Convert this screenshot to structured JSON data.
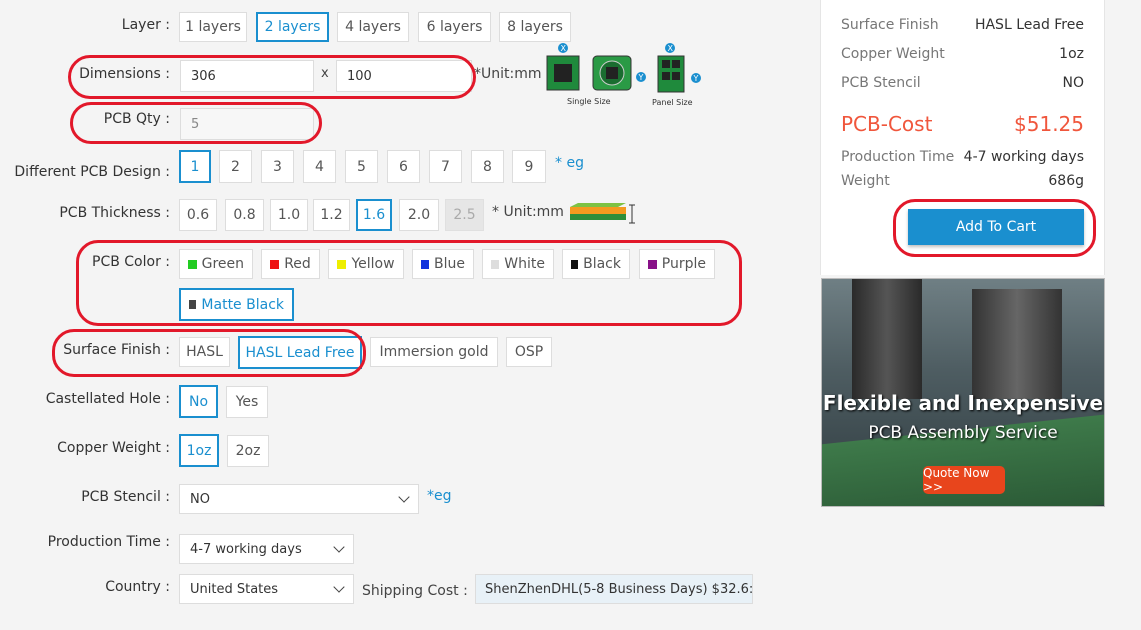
{
  "form": {
    "layer": {
      "label": "Layer :",
      "options": [
        "1 layers",
        "2 layers",
        "4 layers",
        "6 layers",
        "8 layers"
      ]
    },
    "dimensions": {
      "label": "Dimensions :",
      "width": "306",
      "x": "x",
      "height": "100",
      "unit": "*Unit:mm",
      "diagram": {
        "single": "Single Size",
        "panel": "Panel Size",
        "x": "X",
        "y": "Y"
      }
    },
    "qty": {
      "label": "PCB Qty :",
      "value": "5"
    },
    "design": {
      "label": "Different PCB Design :",
      "options": [
        "1",
        "2",
        "3",
        "4",
        "5",
        "6",
        "7",
        "8",
        "9"
      ],
      "eg": "* eg"
    },
    "thickness": {
      "label": "PCB Thickness :",
      "options": [
        "0.6",
        "0.8",
        "1.0",
        "1.2",
        "1.6",
        "2.0",
        "2.5"
      ],
      "unit": "* Unit:mm"
    },
    "color": {
      "label": "PCB Color :",
      "options": [
        {
          "name": "Green",
          "hex": "#22cc22"
        },
        {
          "name": "Red",
          "hex": "#ee1111"
        },
        {
          "name": "Yellow",
          "hex": "#eeee00"
        },
        {
          "name": "Blue",
          "hex": "#1133dd"
        },
        {
          "name": "White",
          "hex": "#dddddd"
        },
        {
          "name": "Black",
          "hex": "#111111"
        },
        {
          "name": "Purple",
          "hex": "#881188"
        },
        {
          "name": "Matte Black",
          "hex": "#444444"
        }
      ]
    },
    "finish": {
      "label": "Surface Finish :",
      "options": [
        "HASL",
        "HASL Lead Free",
        "Immersion gold",
        "OSP"
      ]
    },
    "castellated": {
      "label": "Castellated Hole :",
      "options": [
        "No",
        "Yes"
      ]
    },
    "copper": {
      "label": "Copper Weight :",
      "options": [
        "1oz",
        "2oz"
      ]
    },
    "stencil": {
      "label": "PCB Stencil :",
      "value": "NO",
      "eg": "*eg"
    },
    "production": {
      "label": "Production Time :",
      "value": "4-7 working days"
    },
    "country": {
      "label": "Country :",
      "value": "United States"
    },
    "shipping": {
      "label": "Shipping Cost :",
      "value": "ShenZhenDHL(5-8 Business Days) $32.6:"
    }
  },
  "summary": {
    "rows": [
      {
        "k": "Surface Finish",
        "v": "HASL Lead Free"
      },
      {
        "k": "Copper Weight",
        "v": "1oz"
      },
      {
        "k": "PCB Stencil",
        "v": "NO"
      }
    ],
    "cost_label": "PCB-Cost",
    "cost_value": "$51.25",
    "production_label": "Production Time",
    "production_value": "4-7 working days",
    "weight_label": "Weight",
    "weight_value": "686g",
    "add_to_cart": "Add To Cart"
  },
  "banner": {
    "line1": "Flexible and Inexpensive",
    "line2": "PCB Assembly Service",
    "cta": "Quote Now >>"
  }
}
